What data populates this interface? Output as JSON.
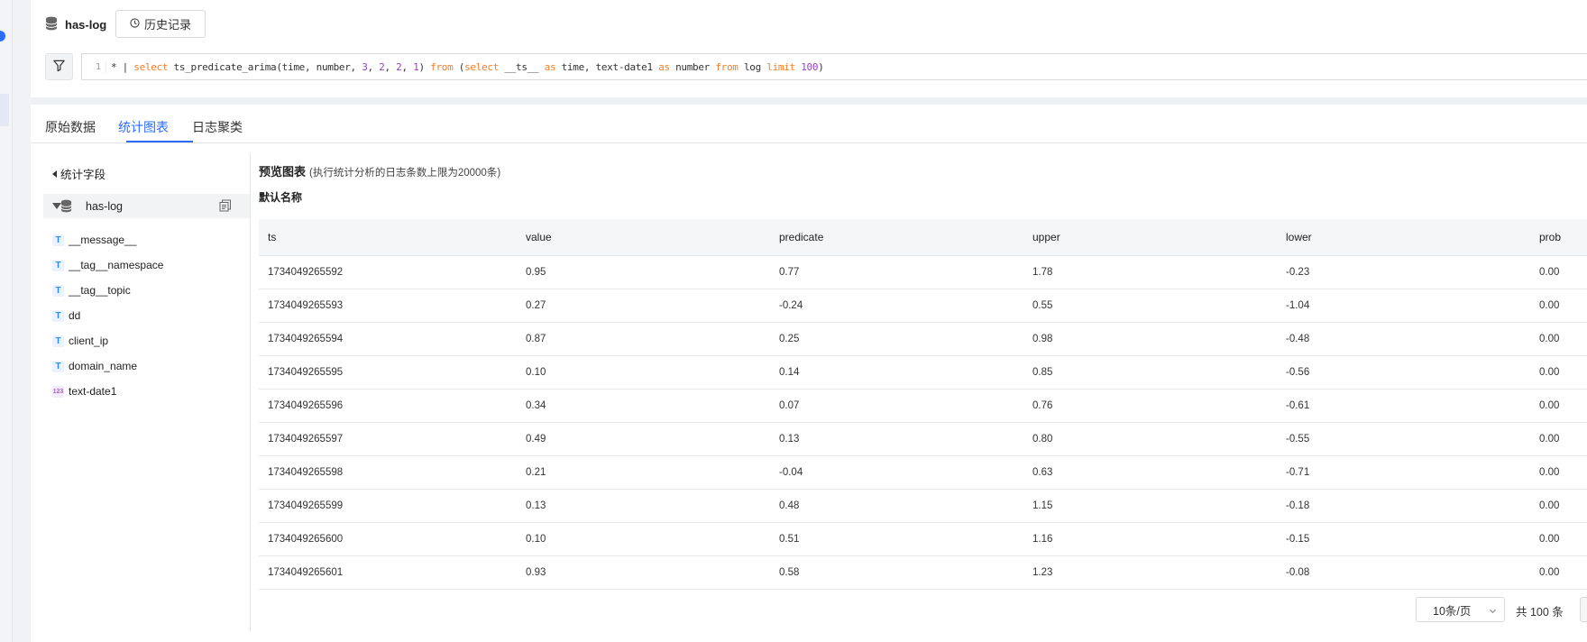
{
  "logstore": {
    "name": "has-log"
  },
  "header": {
    "history_label": "历史记录"
  },
  "query": {
    "line_number": "1",
    "segments": [
      {
        "t": "* | ",
        "c": "plain"
      },
      {
        "t": "select",
        "c": "kw"
      },
      {
        "t": " ts_predicate_arima(time, number, ",
        "c": "plain"
      },
      {
        "t": "3",
        "c": "num"
      },
      {
        "t": ", ",
        "c": "plain"
      },
      {
        "t": "2",
        "c": "num"
      },
      {
        "t": ", ",
        "c": "plain"
      },
      {
        "t": "2",
        "c": "num"
      },
      {
        "t": ", ",
        "c": "plain"
      },
      {
        "t": "1",
        "c": "num"
      },
      {
        "t": ") ",
        "c": "plain"
      },
      {
        "t": "from",
        "c": "kw"
      },
      {
        "t": " (",
        "c": "plain"
      },
      {
        "t": "select",
        "c": "kw"
      },
      {
        "t": " __ts__ ",
        "c": "plain"
      },
      {
        "t": "as",
        "c": "kw"
      },
      {
        "t": " time, text-date1 ",
        "c": "plain"
      },
      {
        "t": "as",
        "c": "kw"
      },
      {
        "t": " number ",
        "c": "plain"
      },
      {
        "t": "from",
        "c": "kw"
      },
      {
        "t": " log ",
        "c": "plain"
      },
      {
        "t": "limit",
        "c": "kw"
      },
      {
        "t": " ",
        "c": "plain"
      },
      {
        "t": "100",
        "c": "num"
      },
      {
        "t": ")",
        "c": "plain"
      }
    ]
  },
  "tabs": [
    {
      "label": "原始数据",
      "active": false
    },
    {
      "label": "统计图表",
      "active": true
    },
    {
      "label": "日志聚类",
      "active": false
    }
  ],
  "fields_panel": {
    "title": "统计字段",
    "logstore_name": "has-log",
    "fields": [
      {
        "name": "__message__",
        "type": "text"
      },
      {
        "name": "__tag__namespace",
        "type": "text"
      },
      {
        "name": "__tag__topic",
        "type": "text"
      },
      {
        "name": "dd",
        "type": "text"
      },
      {
        "name": "client_ip",
        "type": "text"
      },
      {
        "name": "domain_name",
        "type": "text"
      },
      {
        "name": "text-date1",
        "type": "number"
      }
    ]
  },
  "preview": {
    "title": "预览图表",
    "note": "(执行统计分析的日志条数上限为20000条)",
    "chart_name": "默认名称"
  },
  "table": {
    "columns": [
      "ts",
      "value",
      "predicate",
      "upper",
      "lower",
      "prob"
    ],
    "rows": [
      [
        "1734049265592",
        "0.95",
        "0.77",
        "1.78",
        "-0.23",
        "0.00"
      ],
      [
        "1734049265593",
        "0.27",
        "-0.24",
        "0.55",
        "-1.04",
        "0.00"
      ],
      [
        "1734049265594",
        "0.87",
        "0.25",
        "0.98",
        "-0.48",
        "0.00"
      ],
      [
        "1734049265595",
        "0.10",
        "0.14",
        "0.85",
        "-0.56",
        "0.00"
      ],
      [
        "1734049265596",
        "0.34",
        "0.07",
        "0.76",
        "-0.61",
        "0.00"
      ],
      [
        "1734049265597",
        "0.49",
        "0.13",
        "0.80",
        "-0.55",
        "0.00"
      ],
      [
        "1734049265598",
        "0.21",
        "-0.04",
        "0.63",
        "-0.71",
        "0.00"
      ],
      [
        "1734049265599",
        "0.13",
        "0.48",
        "1.15",
        "-0.18",
        "0.00"
      ],
      [
        "1734049265600",
        "0.10",
        "0.51",
        "1.16",
        "-0.15",
        "0.00"
      ],
      [
        "1734049265601",
        "0.93",
        "0.58",
        "1.23",
        "-0.08",
        "0.00"
      ]
    ]
  },
  "pagination": {
    "page_size_label": "10条/页",
    "total_label": "共 100 条"
  },
  "colors": {
    "accent": "#2f6cf6",
    "keyword": "#f07f28",
    "number": "#9c3fc9"
  }
}
